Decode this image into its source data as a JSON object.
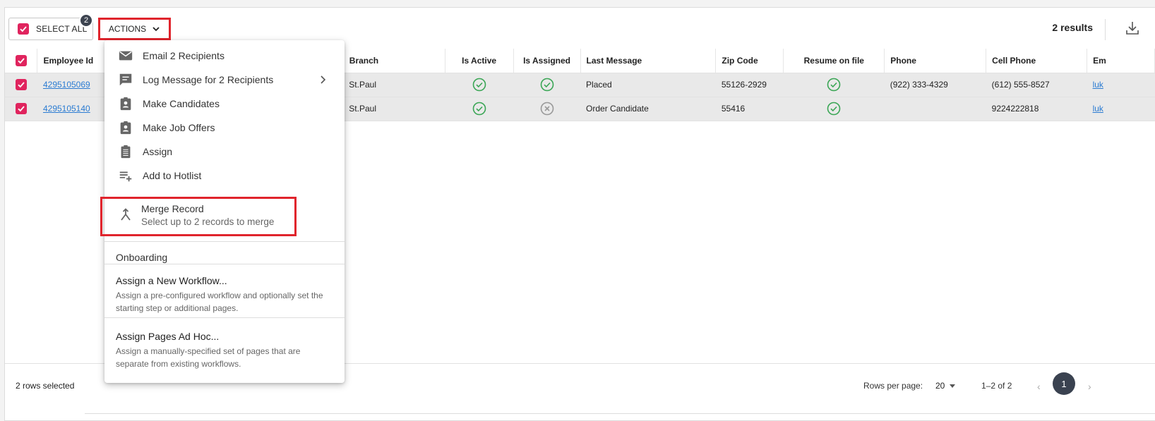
{
  "toolbar": {
    "select_all_label": "SELECT ALL",
    "selected_badge": "2",
    "actions_label": "ACTIONS",
    "results_text": "2 results"
  },
  "table": {
    "columns": [
      "Employee Id",
      "Branch",
      "Is Active",
      "Is Assigned",
      "Last Message",
      "Zip Code",
      "Resume on file",
      "Phone",
      "Cell Phone",
      "Em"
    ],
    "rows": [
      {
        "employee_id": "4295105069",
        "branch": "St.Paul",
        "is_active": "check",
        "is_assigned": "check",
        "last_message": "Placed",
        "zip": "55126-2929",
        "resume": "check",
        "phone": "(922) 333-4329",
        "cell": "(612) 555-8527",
        "email": "luk"
      },
      {
        "employee_id": "4295105140",
        "branch": "St.Paul",
        "is_active": "check",
        "is_assigned": "x",
        "last_message": "Order Candidate",
        "zip": "55416",
        "resume": "check",
        "phone": "",
        "cell": "9224222818",
        "email": "luk"
      }
    ]
  },
  "menu": {
    "items": [
      {
        "label": "Email 2 Recipients",
        "icon": "email-icon"
      },
      {
        "label": "Log Message for 2 Recipients",
        "icon": "message-icon"
      },
      {
        "label": "Make Candidates",
        "icon": "badge-icon"
      },
      {
        "label": "Make Job Offers",
        "icon": "badge-icon"
      },
      {
        "label": "Assign",
        "icon": "clipboard-icon"
      },
      {
        "label": "Add to Hotlist",
        "icon": "playlist-add-icon"
      }
    ],
    "merge": {
      "title": "Merge Record",
      "subtitle": "Select up to 2 records to merge"
    },
    "onboarding": {
      "section_title": "Onboarding",
      "workflow_title": "Assign a New Workflow...",
      "workflow_desc": "Assign a pre-configured workflow and optionally set the starting step or additional pages.",
      "adhoc_title": "Assign Pages Ad Hoc...",
      "adhoc_desc": "Assign a manually-specified set of pages that are separate from existing workflows."
    }
  },
  "footer": {
    "rows_selected": "2 rows selected",
    "rows_per_page_label": "Rows per page:",
    "rows_per_page_value": "20",
    "range": "1–2 of 2",
    "current_page": "1"
  },
  "colors": {
    "accent_pink": "#e0245e",
    "highlight_red": "#e0242c",
    "success_green": "#3aa655",
    "link_blue": "#2a7bd2"
  }
}
